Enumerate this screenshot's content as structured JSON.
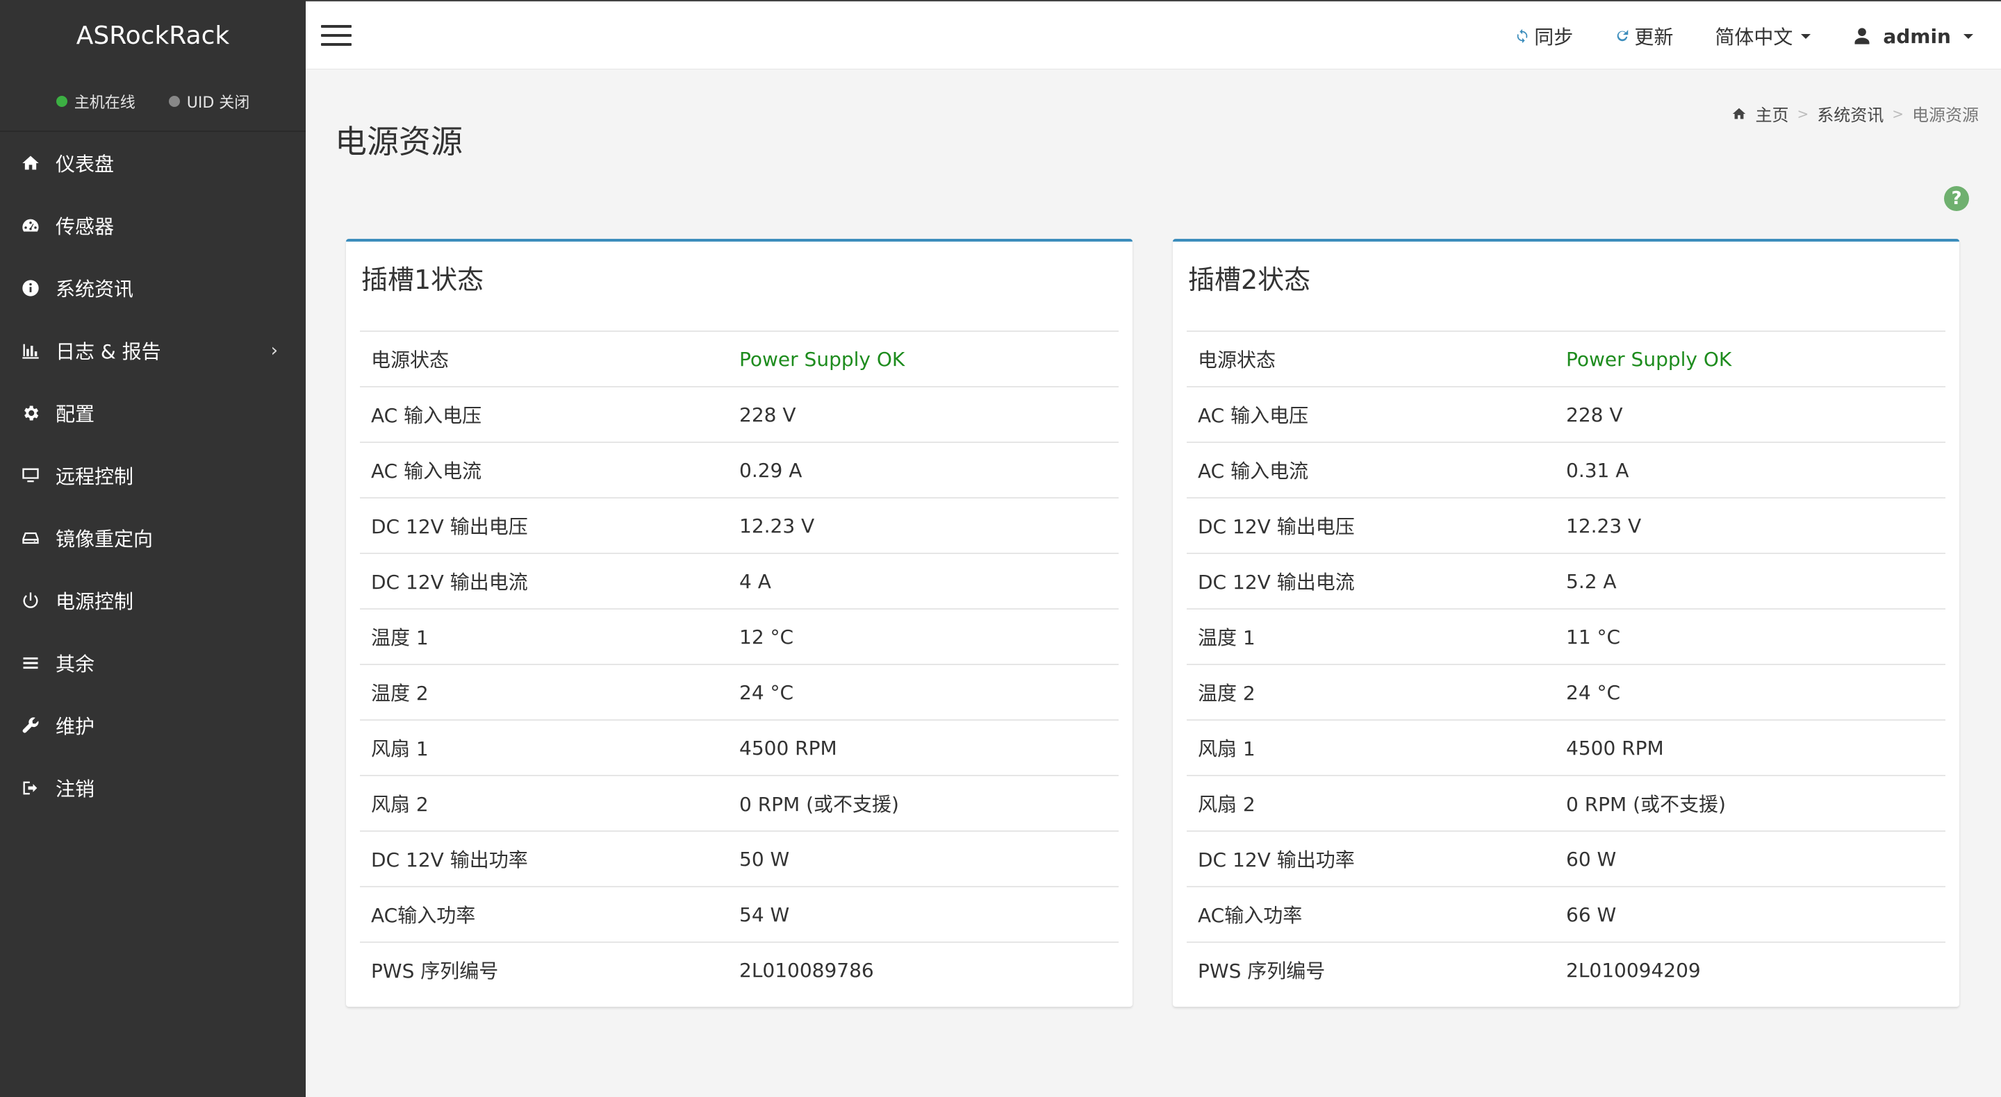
{
  "brand": "ASRockRack",
  "status": {
    "host": {
      "label": "主机在线",
      "color": "#3cb043"
    },
    "uid": {
      "label": "UID 关闭",
      "color": "#888888"
    }
  },
  "nav": [
    {
      "label": "仪表盘",
      "icon": "home-icon"
    },
    {
      "label": "传感器",
      "icon": "dashboard-gauge-icon"
    },
    {
      "label": "系统资讯",
      "icon": "info-circle-icon"
    },
    {
      "label": "日志 & 报告",
      "icon": "bar-chart-icon",
      "chevron": "›"
    },
    {
      "label": "配置",
      "icon": "gear-icon"
    },
    {
      "label": "远程控制",
      "icon": "monitor-icon"
    },
    {
      "label": "镜像重定向",
      "icon": "drive-icon"
    },
    {
      "label": "电源控制",
      "icon": "power-icon"
    },
    {
      "label": "其余",
      "icon": "list-icon"
    },
    {
      "label": "维护",
      "icon": "wrench-icon"
    },
    {
      "label": "注销",
      "icon": "sign-out-icon"
    }
  ],
  "topbar": {
    "sync": "同步",
    "refresh": "更新",
    "language": "简体中文",
    "user": "admin"
  },
  "page": {
    "title": "电源资源",
    "breadcrumb": {
      "home": "主页",
      "sep": ">",
      "middle": "系统资讯",
      "current": "电源资源"
    },
    "help": "?"
  },
  "slots": [
    {
      "title": "插槽1状态",
      "rows": [
        {
          "label": "电源状态",
          "value": "Power Supply OK"
        },
        {
          "label": "AC 输入电压",
          "value": "228 V"
        },
        {
          "label": "AC 输入电流",
          "value": "0.29 A"
        },
        {
          "label": "DC 12V 输出电压",
          "value": "12.23 V"
        },
        {
          "label": "DC 12V 输出电流",
          "value": "4 A"
        },
        {
          "label": "温度 1",
          "value": "12 °C"
        },
        {
          "label": "温度 2",
          "value": "24 °C"
        },
        {
          "label": "风扇 1",
          "value": "4500 RPM"
        },
        {
          "label": "风扇 2",
          "value": "0 RPM (或不支援)"
        },
        {
          "label": "DC 12V 输出功率",
          "value": "50 W"
        },
        {
          "label": "AC输入功率",
          "value": "54 W"
        },
        {
          "label": "PWS 序列编号",
          "value": "2L010089786"
        }
      ]
    },
    {
      "title": "插槽2状态",
      "rows": [
        {
          "label": "电源状态",
          "value": "Power Supply OK"
        },
        {
          "label": "AC 输入电压",
          "value": "228 V"
        },
        {
          "label": "AC 输入电流",
          "value": "0.31 A"
        },
        {
          "label": "DC 12V 输出电压",
          "value": "12.23 V"
        },
        {
          "label": "DC 12V 输出电流",
          "value": "5.2 A"
        },
        {
          "label": "温度 1",
          "value": "11 °C"
        },
        {
          "label": "温度 2",
          "value": "24 °C"
        },
        {
          "label": "风扇 1",
          "value": "4500 RPM"
        },
        {
          "label": "风扇 2",
          "value": "0 RPM (或不支援)"
        },
        {
          "label": "DC 12V 输出功率",
          "value": "60 W"
        },
        {
          "label": "AC输入功率",
          "value": "66 W"
        },
        {
          "label": "PWS 序列编号",
          "value": "2L010094209"
        }
      ]
    }
  ],
  "colors": {
    "sidebar": "#333333",
    "accent": "#3c8dbc",
    "ok": "#1e8c1e"
  }
}
